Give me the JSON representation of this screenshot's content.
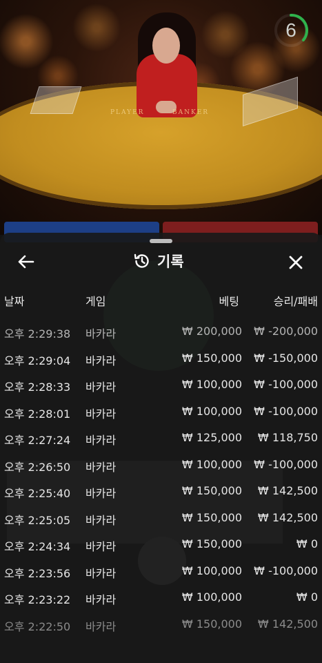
{
  "live": {
    "timer": "6",
    "table_labels": {
      "player": "PLAYER",
      "banker": "BANKER"
    }
  },
  "history": {
    "title": "기록",
    "columns": {
      "date": "날짜",
      "game": "게임",
      "bet": "베팅",
      "result": "승리/패배"
    },
    "rows": [
      {
        "time": "오후 2:29:38",
        "game": "바카라",
        "bet": "₩ 200,000",
        "result": "₩ -200,000"
      },
      {
        "time": "오후 2:29:04",
        "game": "바카라",
        "bet": "₩ 150,000",
        "result": "₩ -150,000"
      },
      {
        "time": "오후 2:28:33",
        "game": "바카라",
        "bet": "₩ 100,000",
        "result": "₩ -100,000"
      },
      {
        "time": "오후 2:28:01",
        "game": "바카라",
        "bet": "₩ 100,000",
        "result": "₩ -100,000"
      },
      {
        "time": "오후 2:27:24",
        "game": "바카라",
        "bet": "₩ 125,000",
        "result": "₩ 118,750"
      },
      {
        "time": "오후 2:26:50",
        "game": "바카라",
        "bet": "₩ 100,000",
        "result": "₩ -100,000"
      },
      {
        "time": "오후 2:25:40",
        "game": "바카라",
        "bet": "₩ 150,000",
        "result": "₩ 142,500"
      },
      {
        "time": "오후 2:25:05",
        "game": "바카라",
        "bet": "₩ 150,000",
        "result": "₩ 142,500"
      },
      {
        "time": "오후 2:24:34",
        "game": "바카라",
        "bet": "₩ 150,000",
        "result": "₩ 0"
      },
      {
        "time": "오후 2:23:56",
        "game": "바카라",
        "bet": "₩ 100,000",
        "result": "₩ -100,000"
      },
      {
        "time": "오후 2:23:22",
        "game": "바카라",
        "bet": "₩ 100,000",
        "result": "₩ 0"
      },
      {
        "time": "오후 2:22:50",
        "game": "바카라",
        "bet": "₩ 150,000",
        "result": "₩ 142,500"
      }
    ]
  },
  "colors": {
    "timer_ring": "#2fb24c",
    "player": "#1d3f86",
    "banker": "#7e1e1e"
  },
  "icons": {
    "back": "arrow-left-icon",
    "title": "history-icon",
    "close": "close-icon"
  }
}
